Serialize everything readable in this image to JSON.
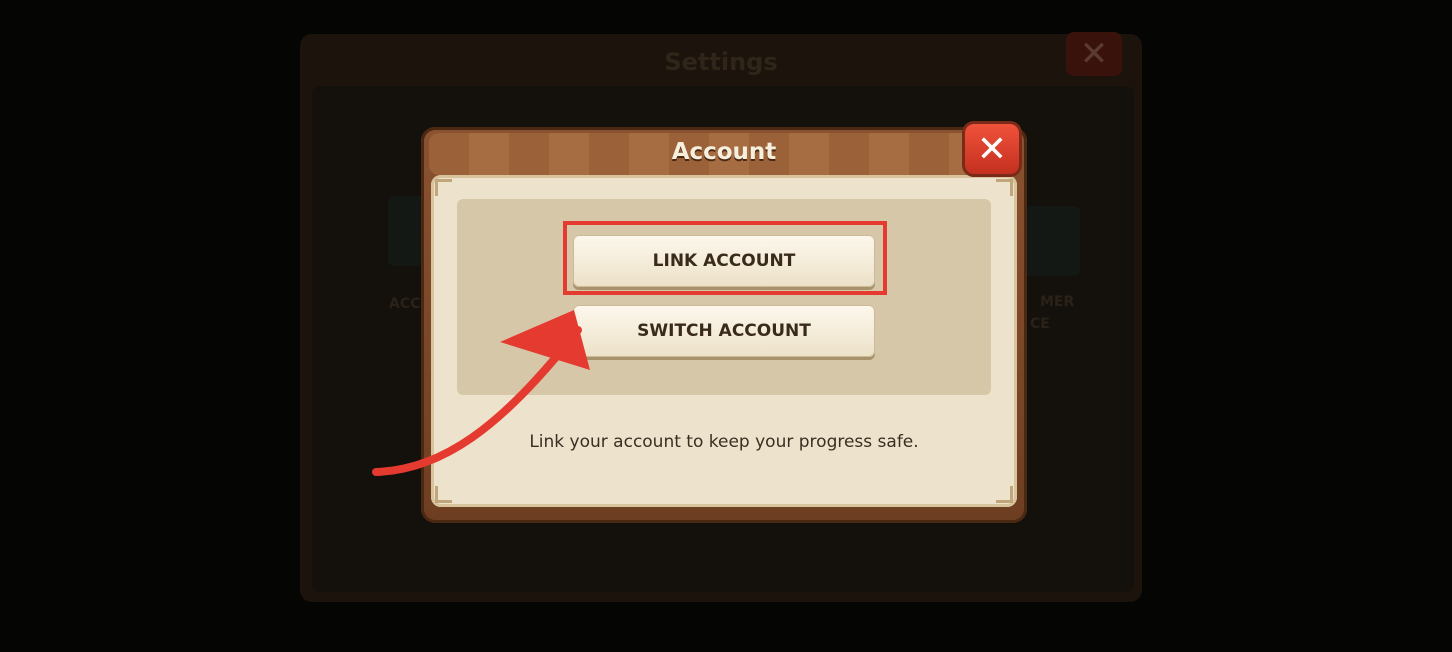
{
  "background": {
    "settings_title": "Settings",
    "labels": [
      "ACC",
      "MER",
      "CE"
    ]
  },
  "dialog": {
    "title": "Account",
    "link_account_label": "LINK ACCOUNT",
    "switch_account_label": "SWITCH ACCOUNT",
    "hint_text": "Link your account to keep your progress safe."
  },
  "colors": {
    "highlight": "#e53a2f",
    "close_button": "#d83a27",
    "dialog_frame": "#8a5230",
    "panel": "#ede2cb"
  },
  "icons": {
    "close": "close-icon",
    "annotation_arrow": "arrow-annotation"
  }
}
